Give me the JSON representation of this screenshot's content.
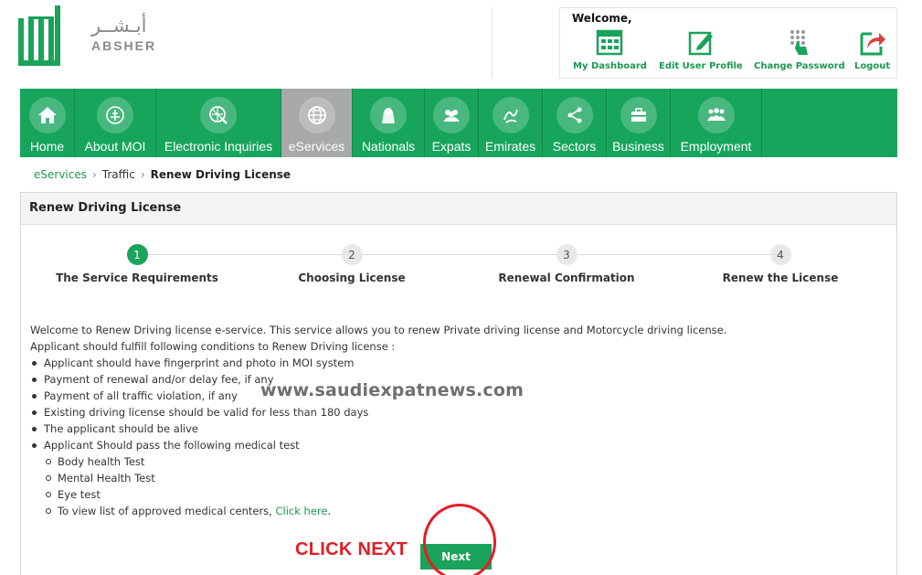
{
  "brand": {
    "arabic_name": "أبـشــر",
    "english_name": "ABSHER",
    "color": "#1aa35a"
  },
  "user_panel": {
    "welcome": "Welcome,",
    "actions": [
      {
        "label": "My Dashboard",
        "icon": "dashboard-icon"
      },
      {
        "label": "Edit User Profile",
        "icon": "edit-profile-icon"
      },
      {
        "label": "Change Password",
        "icon": "change-password-icon"
      },
      {
        "label": "Logout",
        "icon": "logout-icon"
      }
    ]
  },
  "nav": {
    "items": [
      {
        "label": "Home",
        "icon": "home-icon",
        "active": false
      },
      {
        "label": "About MOI",
        "icon": "moi-emblem-icon",
        "active": false
      },
      {
        "label": "Electronic Inquiries",
        "icon": "inquiries-icon",
        "active": false
      },
      {
        "label": "eServices",
        "icon": "globe-icon",
        "active": true
      },
      {
        "label": "Nationals",
        "icon": "nationals-icon",
        "active": false
      },
      {
        "label": "Expats",
        "icon": "people-icon",
        "active": false
      },
      {
        "label": "Emirates",
        "icon": "emirates-icon",
        "active": false
      },
      {
        "label": "Sectors",
        "icon": "sectors-icon",
        "active": false
      },
      {
        "label": "Business",
        "icon": "briefcase-icon",
        "active": false
      },
      {
        "label": "Employment",
        "icon": "employment-icon",
        "active": false
      }
    ],
    "colors": {
      "bar": "#17a55c",
      "active": "#a7a9ab"
    }
  },
  "breadcrumb": {
    "items": [
      "eServices",
      "Traffic",
      "Renew Driving License"
    ]
  },
  "panel": {
    "title": "Renew Driving License",
    "steps": [
      {
        "number": "1",
        "label": "The Service Requirements",
        "current": true
      },
      {
        "number": "2",
        "label": "Choosing License",
        "current": false
      },
      {
        "number": "3",
        "label": "Renewal Confirmation",
        "current": false
      },
      {
        "number": "4",
        "label": "Renew the License",
        "current": false
      }
    ],
    "intro": "Welcome to Renew Driving license e-service. This service allows you to renew Private driving license and Motorcycle driving license.",
    "conditions_heading": "Applicant should fulfill following conditions to Renew Driving license :",
    "conditions": [
      "Applicant should have fingerprint and photo in MOI system",
      "Payment of renewal and/or delay fee, if any",
      "Payment of all traffic violation, if any",
      "Existing driving license should be valid for less than 180 days",
      "The applicant should be alive",
      "Applicant Should pass the following medical test"
    ],
    "medical_tests": [
      "Body health Test",
      "Mental Health Test",
      "Eye test"
    ],
    "medical_centers_text": "To view list of approved medical centers, ",
    "medical_centers_link": "Click here",
    "medical_centers_end": "."
  },
  "watermark": "www.saudiexpatnews.com",
  "annotation": {
    "text": "CLICK NEXT",
    "color": "#e21e26"
  },
  "next_button": {
    "label": "Next"
  }
}
